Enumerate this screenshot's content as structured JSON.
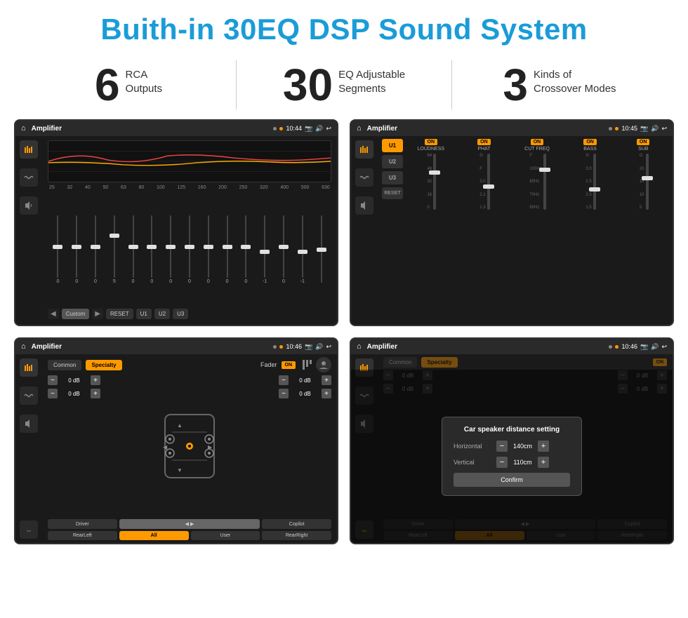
{
  "header": {
    "title": "Buith-in 30EQ DSP Sound System",
    "title_color": "#1a9cd8"
  },
  "stats": [
    {
      "number": "6",
      "label": "RCA\nOutputs"
    },
    {
      "number": "30",
      "label": "EQ Adjustable\nSegments"
    },
    {
      "number": "3",
      "label": "Kinds of\nCrossover Modes"
    }
  ],
  "screens": [
    {
      "id": "eq-screen",
      "status_bar": {
        "app_name": "Amplifier",
        "time": "10:44"
      },
      "type": "eq"
    },
    {
      "id": "crossover-screen",
      "status_bar": {
        "app_name": "Amplifier",
        "time": "10:45"
      },
      "type": "crossover"
    },
    {
      "id": "fader-screen",
      "status_bar": {
        "app_name": "Amplifier",
        "time": "10:46"
      },
      "type": "fader"
    },
    {
      "id": "distance-screen",
      "status_bar": {
        "app_name": "Amplifier",
        "time": "10:46"
      },
      "type": "distance"
    }
  ],
  "eq": {
    "freq_labels": [
      "25",
      "32",
      "40",
      "50",
      "63",
      "80",
      "100",
      "125",
      "160",
      "200",
      "250",
      "320",
      "400",
      "500",
      "630"
    ],
    "values": [
      "0",
      "0",
      "0",
      "5",
      "0",
      "0",
      "0",
      "0",
      "0",
      "0",
      "0",
      "-1",
      "0",
      "-1",
      ""
    ],
    "buttons": [
      "Custom",
      "RESET",
      "U1",
      "U2",
      "U3"
    ]
  },
  "crossover": {
    "presets": [
      "U1",
      "U2",
      "U3"
    ],
    "channels": [
      {
        "name": "LOUDNESS",
        "on": true
      },
      {
        "name": "PHAT",
        "on": true
      },
      {
        "name": "CUT FREQ",
        "on": true
      },
      {
        "name": "BASS",
        "on": true
      },
      {
        "name": "SUB",
        "on": true
      }
    ],
    "reset_label": "RESET"
  },
  "fader": {
    "tabs": [
      "Common",
      "Specialty"
    ],
    "fader_label": "Fader",
    "on_label": "ON",
    "db_values": [
      "0 dB",
      "0 dB",
      "0 dB",
      "0 dB"
    ],
    "locations": [
      "Driver",
      "Copilot",
      "RearLeft",
      "All",
      "User",
      "RearRight"
    ]
  },
  "distance": {
    "title": "Car speaker distance setting",
    "horizontal_label": "Horizontal",
    "horizontal_value": "140cm",
    "vertical_label": "Vertical",
    "vertical_value": "110cm",
    "confirm_label": "Confirm",
    "tabs": [
      "Common",
      "Specialty"
    ],
    "db_values": [
      "0 dB",
      "0 dB"
    ],
    "locations": [
      "Driver",
      "Copilot",
      "RearLeft",
      "All",
      "User",
      "RearRight"
    ]
  }
}
